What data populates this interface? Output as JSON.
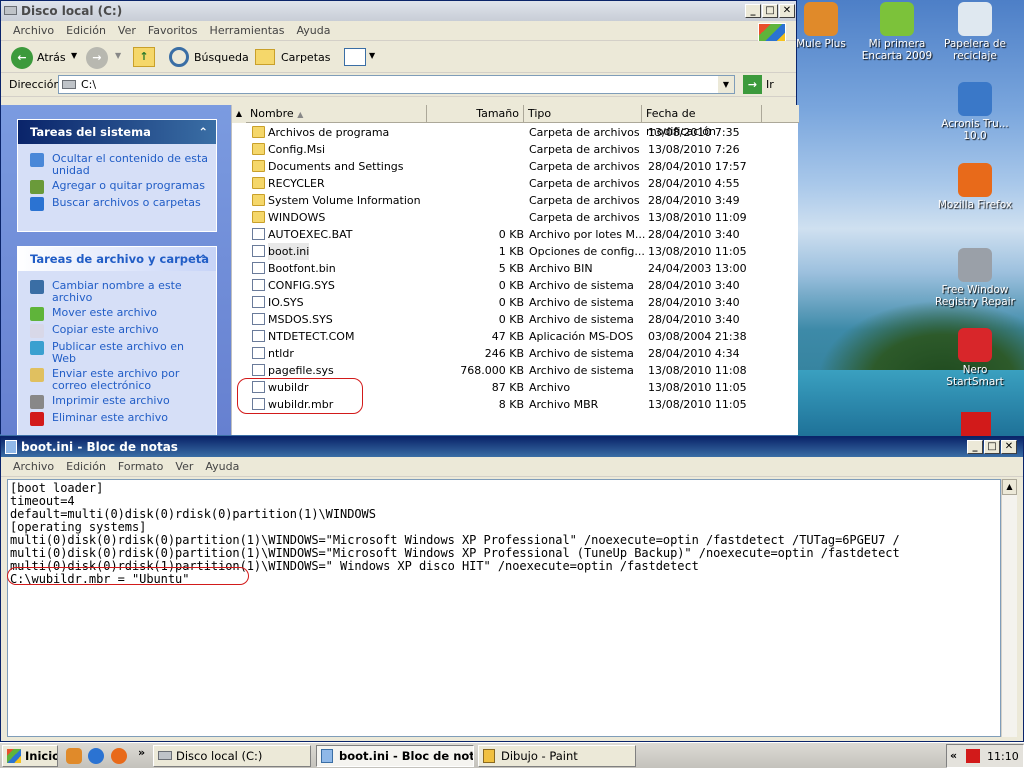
{
  "explorer": {
    "title": "Disco local (C:)",
    "menu": [
      "Archivo",
      "Edición",
      "Ver",
      "Favoritos",
      "Herramientas",
      "Ayuda"
    ],
    "toolbar": {
      "back": "Atrás",
      "search": "Búsqueda",
      "folders": "Carpetas"
    },
    "address": {
      "label": "Dirección",
      "value": "C:\\",
      "go": "Ir"
    },
    "system_tasks": {
      "title": "Tareas del sistema",
      "items": [
        "Ocultar el contenido de esta unidad",
        "Agregar o quitar programas",
        "Buscar archivos o carpetas"
      ]
    },
    "file_tasks": {
      "title": "Tareas de archivo y carpeta",
      "items": [
        "Cambiar nombre a este archivo",
        "Mover este archivo",
        "Copiar este archivo",
        "Publicar este archivo en Web",
        "Enviar este archivo por correo electrónico",
        "Imprimir este archivo",
        "Eliminar este archivo"
      ]
    },
    "columns": {
      "name": "Nombre",
      "size": "Tamaño",
      "type": "Tipo",
      "date": "Fecha de modificación"
    },
    "files": [
      {
        "name": "Archivos de programa",
        "size": "",
        "type": "Carpeta de archivos",
        "date": "13/08/2010 7:35",
        "folder": true
      },
      {
        "name": "Config.Msi",
        "size": "",
        "type": "Carpeta de archivos",
        "date": "13/08/2010 7:26",
        "folder": true
      },
      {
        "name": "Documents and Settings",
        "size": "",
        "type": "Carpeta de archivos",
        "date": "28/04/2010 17:57",
        "folder": true
      },
      {
        "name": "RECYCLER",
        "size": "",
        "type": "Carpeta de archivos",
        "date": "28/04/2010 4:55",
        "folder": true
      },
      {
        "name": "System Volume Information",
        "size": "",
        "type": "Carpeta de archivos",
        "date": "28/04/2010 3:49",
        "folder": true
      },
      {
        "name": "WINDOWS",
        "size": "",
        "type": "Carpeta de archivos",
        "date": "13/08/2010 11:09",
        "folder": true
      },
      {
        "name": "AUTOEXEC.BAT",
        "size": "0 KB",
        "type": "Archivo por lotes M...",
        "date": "28/04/2010 3:40",
        "folder": false
      },
      {
        "name": "boot.ini",
        "size": "1 KB",
        "type": "Opciones de config...",
        "date": "13/08/2010 11:05",
        "folder": false
      },
      {
        "name": "Bootfont.bin",
        "size": "5 KB",
        "type": "Archivo BIN",
        "date": "24/04/2003 13:00",
        "folder": false
      },
      {
        "name": "CONFIG.SYS",
        "size": "0 KB",
        "type": "Archivo de sistema",
        "date": "28/04/2010 3:40",
        "folder": false
      },
      {
        "name": "IO.SYS",
        "size": "0 KB",
        "type": "Archivo de sistema",
        "date": "28/04/2010 3:40",
        "folder": false
      },
      {
        "name": "MSDOS.SYS",
        "size": "0 KB",
        "type": "Archivo de sistema",
        "date": "28/04/2010 3:40",
        "folder": false
      },
      {
        "name": "NTDETECT.COM",
        "size": "47 KB",
        "type": "Aplicación MS-DOS",
        "date": "03/08/2004 21:38",
        "folder": false
      },
      {
        "name": "ntldr",
        "size": "246 KB",
        "type": "Archivo de sistema",
        "date": "28/04/2010 4:34",
        "folder": false
      },
      {
        "name": "pagefile.sys",
        "size": "768.000 KB",
        "type": "Archivo de sistema",
        "date": "13/08/2010 11:08",
        "folder": false
      },
      {
        "name": "wubildr",
        "size": "87 KB",
        "type": "Archivo",
        "date": "13/08/2010 11:05",
        "folder": false
      },
      {
        "name": "wubildr.mbr",
        "size": "8 KB",
        "type": "Archivo MBR",
        "date": "13/08/2010 11:05",
        "folder": false
      }
    ]
  },
  "desktop": [
    {
      "label": "Mule Plus",
      "color": "#e08a2a"
    },
    {
      "label": "Mi primera Encarta 2009",
      "color": "#7cc23a"
    },
    {
      "label": "Papelera de reciclaje",
      "color": "#dfe8f0"
    },
    {
      "label": "Acronis Tru... 10.0",
      "color": "#3a78c8"
    },
    {
      "label": "Mozilla Firefox",
      "color": "#e86a1a"
    },
    {
      "label": "Free Window Registry Repair",
      "color": "#9aa0a8"
    },
    {
      "label": "Nero StartSmart",
      "color": "#d8262a"
    }
  ],
  "notepad": {
    "title": "boot.ini - Bloc de notas",
    "menu": [
      "Archivo",
      "Edición",
      "Formato",
      "Ver",
      "Ayuda"
    ],
    "lines": [
      "[boot loader]",
      "timeout=4",
      "default=multi(0)disk(0)rdisk(0)partition(1)\\WINDOWS",
      "[operating systems]",
      "multi(0)disk(0)rdisk(0)partition(1)\\WINDOWS=\"Microsoft Windows XP Professional\" /noexecute=optin /fastdetect /TUTag=6PGEU7 /",
      "multi(0)disk(0)rdisk(0)partition(1)\\WINDOWS=\"Microsoft Windows XP Professional (TuneUp Backup)\" /noexecute=optin /fastdetect",
      "multi(0)disk(0)rdisk(1)partition(1)\\WINDOWS=\" Windows XP disco HIT\" /noexecute=optin /fastdetect",
      "C:\\wubildr.mbr = \"Ubuntu\""
    ]
  },
  "taskbar": {
    "start": "Inicio",
    "items": [
      "Disco local (C:)",
      "boot.ini - Bloc de notas",
      "Dibujo - Paint"
    ],
    "chevron": "«",
    "clock": "11:10"
  }
}
